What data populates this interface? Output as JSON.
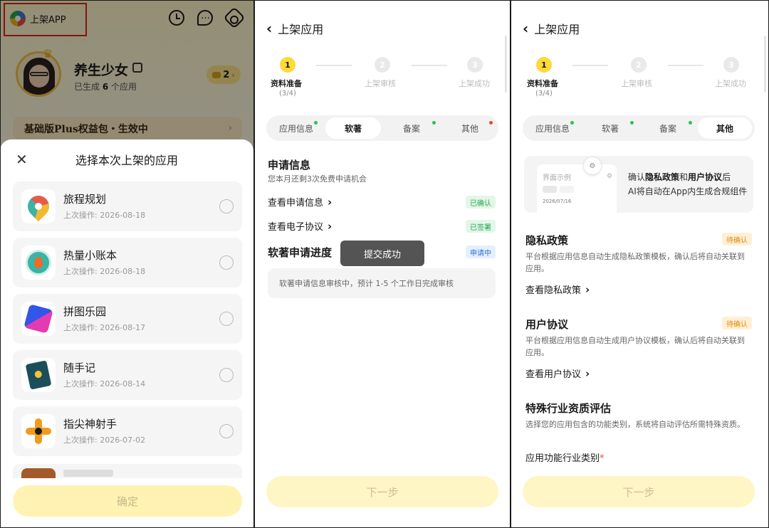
{
  "screen1": {
    "brand_label": "上架APP",
    "profile": {
      "name": "养生少女",
      "stat_prefix": "已生成",
      "stat_count": "6",
      "stat_suffix": "个应用",
      "coins": "2"
    },
    "plus_banner": "基础版Plus权益包・生效中",
    "sheet": {
      "title": "选择本次上架的应用",
      "apps": [
        {
          "name": "旅程规划",
          "last_op": "上次操作: 2026-08-18",
          "icon": "map-pin-icon"
        },
        {
          "name": "热量小账本",
          "last_op": "上次操作: 2026-08-18",
          "icon": "plate-fire-icon"
        },
        {
          "name": "拼图乐园",
          "last_op": "上次操作: 2026-08-17",
          "icon": "puzzle-icon"
        },
        {
          "name": "随手记",
          "last_op": "上次操作: 2026-08-14",
          "icon": "notebook-icon"
        },
        {
          "name": "指尖神射手",
          "last_op": "上次操作: 2026-07-02",
          "icon": "crosshair-icon"
        }
      ],
      "confirm_label": "确定"
    }
  },
  "screen2": {
    "nav_title": "上架应用",
    "steps": [
      {
        "num": "1",
        "label": "资料准备",
        "sub": "(3/4)"
      },
      {
        "num": "2",
        "label": "上架审核"
      },
      {
        "num": "3",
        "label": "上架成功"
      }
    ],
    "tabs": [
      "应用信息",
      "软著",
      "备案",
      "其他"
    ],
    "active_tab": "软著",
    "apply_title": "申请信息",
    "apply_sub": "您本月还剩3次免费申请机会",
    "view_apply_info": "查看申请信息",
    "view_apply_badge": "已确认",
    "view_contract": "查看电子协议",
    "view_contract_badge": "已签署",
    "progress_title": "软著申请进度",
    "progress_badge": "申请中",
    "toast": "提交成功",
    "progress_note": "软著申请信息审核中，预计 1-5 个工作日完成审核",
    "next_label": "下一步"
  },
  "screen3": {
    "nav_title": "上架应用",
    "steps": [
      {
        "num": "1",
        "label": "资料准备",
        "sub": "(3/4)"
      },
      {
        "num": "2",
        "label": "上架审核"
      },
      {
        "num": "3",
        "label": "上架成功"
      }
    ],
    "tabs": [
      "应用信息",
      "软著",
      "备案",
      "其他"
    ],
    "active_tab": "其他",
    "preview": {
      "mock_title": "界面示例",
      "mock_date": "2026/07/16",
      "line1_prefix": "确认",
      "line1_privacy": "隐私政策",
      "line1_and": "和",
      "line1_agreement": "用户协议",
      "line1_suffix": "后",
      "line2": "AI将自动在App内生成合规组件"
    },
    "privacy": {
      "title": "隐私政策",
      "badge": "待确认",
      "desc": "平台根据应用信息自动生成隐私政策模板，确认后将自动关联到应用。",
      "link": "查看隐私政策"
    },
    "agreement": {
      "title": "用户协议",
      "badge": "待确认",
      "desc": "平台根据应用信息自动生成用户协议模板，确认后将自动关联到应用。",
      "link": "查看用户协议"
    },
    "special": {
      "title": "特殊行业资质评估",
      "desc": "选择您的应用包含的功能类别，系统将自动评估所需特殊资质。",
      "field_label": "应用功能行业类别",
      "required_mark": "*"
    },
    "next_label": "下一步"
  },
  "colors": {
    "accent_yellow": "#ffd83a",
    "highlight_red": "#e0261c",
    "status_green": "#27a750",
    "status_blue": "#2f6fe8",
    "status_orange": "#e28a10"
  }
}
